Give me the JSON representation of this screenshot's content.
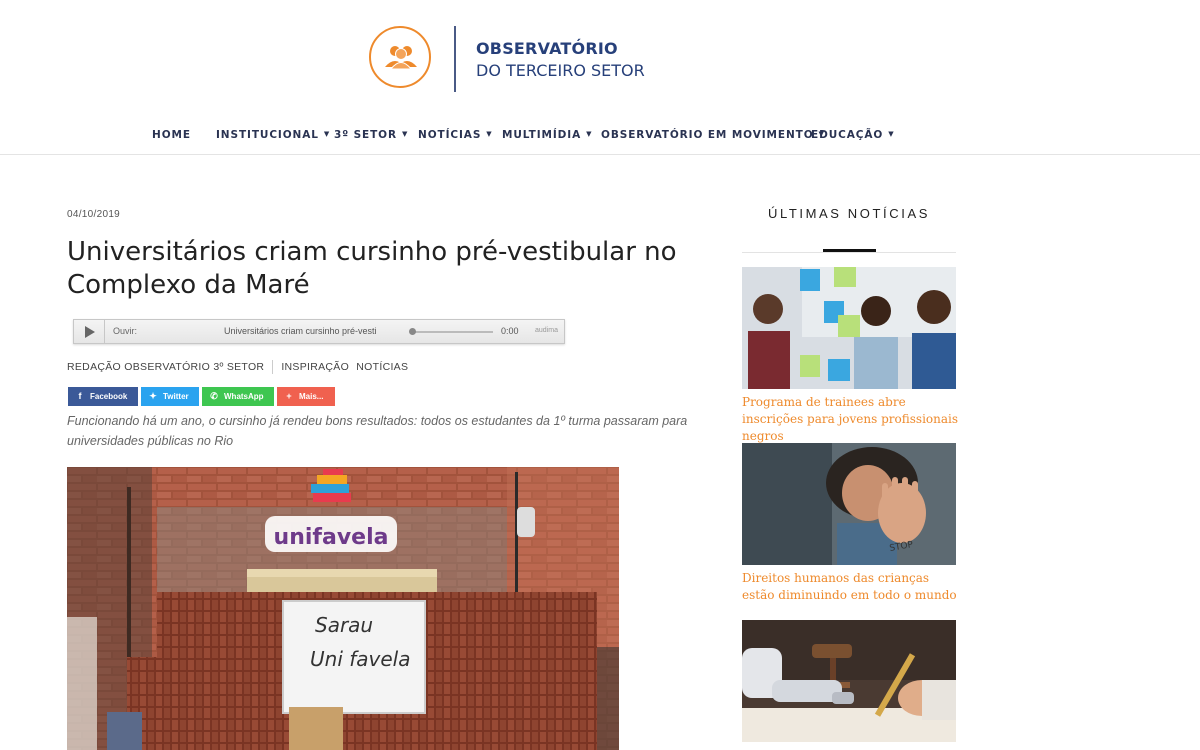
{
  "header": {
    "logo_line1": "OBSERVATÓRIO",
    "logo_line2": "DO TERCEIRO SETOR",
    "logo_icon": "people-group-icon",
    "accent_color": "#ee8a2c",
    "brand_color": "#27407a"
  },
  "nav": {
    "items": [
      {
        "label": "HOME",
        "dropdown": false
      },
      {
        "label": "INSTITUCIONAL",
        "dropdown": true
      },
      {
        "label": "3º SETOR",
        "dropdown": true
      },
      {
        "label": "NOTÍCIAS",
        "dropdown": true
      },
      {
        "label": "MULTIMÍDIA",
        "dropdown": true
      },
      {
        "label": "OBSERVATÓRIO EM MOVIMENTO",
        "dropdown": true
      },
      {
        "label": "EDUCAÇÃO",
        "dropdown": true
      }
    ],
    "caret": "▼"
  },
  "article": {
    "date": "04/10/2019",
    "title": "Universitários criam cursinho pré-vestibular no Complexo da Maré",
    "player": {
      "listen_label": "Ouvir:",
      "track_title": "Universitários criam cursinho pré-vesti",
      "time": "0:00",
      "brand": "audima",
      "progress": 0
    },
    "author": "REDAÇÃO OBSERVATÓRIO 3º SETOR",
    "categories": [
      "INSPIRAÇÃO",
      "NOTÍCIAS"
    ],
    "share": {
      "facebook": "Facebook",
      "twitter": "Twitter",
      "whatsapp": "WhatsApp",
      "more": "Mais..."
    },
    "excerpt": "Funcionando há um ano, o cursinho já rendeu bons resultados: todos os estudantes da 1º turma passaram para universidades públicas no Rio",
    "image": {
      "sign_text": "unifavela",
      "whiteboard_line1": "Sarau",
      "whiteboard_line2": "Uni favela"
    }
  },
  "sidebar": {
    "title": "ÚLTIMAS NOTÍCIAS",
    "news": [
      {
        "title": "Programa de trainees abre inscrições para jovens profissionais negros"
      },
      {
        "title": "Direitos humanos das crianças estão diminuindo em todo o mundo",
        "image_text": "STOP"
      },
      {
        "title": ""
      }
    ]
  }
}
